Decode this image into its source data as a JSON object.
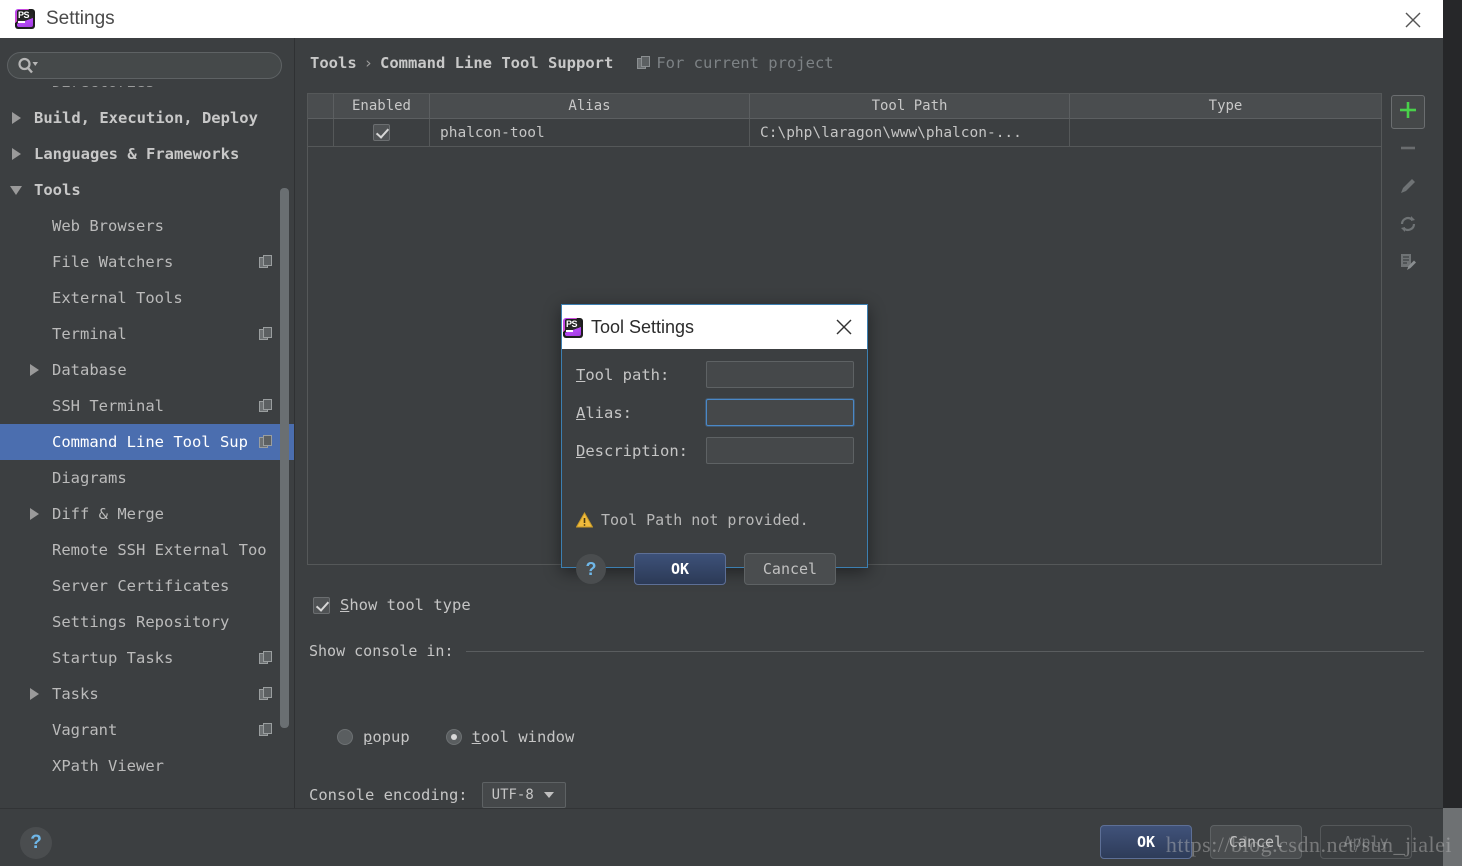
{
  "window": {
    "title": "Settings",
    "logo_text": "PS",
    "close_icon": "close-icon"
  },
  "sidebar": {
    "search": {
      "value": "",
      "placeholder": "",
      "icon": "search-icon"
    },
    "items": [
      {
        "label": "Directories",
        "level": 1,
        "arrow": "none",
        "copy": true,
        "clipped": true,
        "selected": false
      },
      {
        "label": "Build, Execution, Deploy",
        "level": 0,
        "arrow": "right",
        "copy": false,
        "clipped": false,
        "selected": false
      },
      {
        "label": "Languages & Frameworks",
        "level": 0,
        "arrow": "right",
        "copy": false,
        "clipped": false,
        "selected": false
      },
      {
        "label": "Tools",
        "level": 0,
        "arrow": "down",
        "copy": false,
        "clipped": false,
        "selected": false
      },
      {
        "label": "Web Browsers",
        "level": 1,
        "arrow": "none",
        "copy": false,
        "clipped": false,
        "selected": false
      },
      {
        "label": "File Watchers",
        "level": 1,
        "arrow": "none",
        "copy": true,
        "clipped": false,
        "selected": false
      },
      {
        "label": "External Tools",
        "level": 1,
        "arrow": "none",
        "copy": false,
        "clipped": false,
        "selected": false
      },
      {
        "label": "Terminal",
        "level": 1,
        "arrow": "none",
        "copy": true,
        "clipped": false,
        "selected": false
      },
      {
        "label": "Database",
        "level": 1,
        "arrow": "right",
        "copy": false,
        "clipped": false,
        "selected": false
      },
      {
        "label": "SSH Terminal",
        "level": 1,
        "arrow": "none",
        "copy": true,
        "clipped": false,
        "selected": false
      },
      {
        "label": "Command Line Tool Sup",
        "level": 1,
        "arrow": "none",
        "copy": true,
        "clipped": false,
        "selected": true
      },
      {
        "label": "Diagrams",
        "level": 1,
        "arrow": "none",
        "copy": false,
        "clipped": false,
        "selected": false
      },
      {
        "label": "Diff & Merge",
        "level": 1,
        "arrow": "right",
        "copy": false,
        "clipped": false,
        "selected": false
      },
      {
        "label": "Remote SSH External Too",
        "level": 1,
        "arrow": "none",
        "copy": false,
        "clipped": false,
        "selected": false
      },
      {
        "label": "Server Certificates",
        "level": 1,
        "arrow": "none",
        "copy": false,
        "clipped": false,
        "selected": false
      },
      {
        "label": "Settings Repository",
        "level": 1,
        "arrow": "none",
        "copy": false,
        "clipped": false,
        "selected": false
      },
      {
        "label": "Startup Tasks",
        "level": 1,
        "arrow": "none",
        "copy": true,
        "clipped": false,
        "selected": false
      },
      {
        "label": "Tasks",
        "level": 1,
        "arrow": "right",
        "copy": true,
        "clipped": false,
        "selected": false
      },
      {
        "label": "Vagrant",
        "level": 1,
        "arrow": "none",
        "copy": true,
        "clipped": false,
        "selected": false
      },
      {
        "label": "XPath Viewer",
        "level": 1,
        "arrow": "none",
        "copy": false,
        "clipped": false,
        "selected": false
      }
    ]
  },
  "main": {
    "breadcrumb": {
      "root": "Tools",
      "separator": "›",
      "leaf": "Command Line Tool Support"
    },
    "scope_label": "For current project",
    "table": {
      "columns": [
        "",
        "Enabled",
        "Alias",
        "Tool Path",
        "Type"
      ],
      "rows": [
        {
          "enabled": true,
          "alias": "phalcon-tool",
          "tool_path": "C:\\php\\laragon\\www\\phalcon-...",
          "type": ""
        }
      ]
    },
    "toolbar": [
      {
        "name": "add-button",
        "icon": "plus-icon",
        "selected": true
      },
      {
        "name": "remove-button",
        "icon": "minus-icon",
        "selected": false
      },
      {
        "name": "edit-button",
        "icon": "pencil-icon",
        "selected": false
      },
      {
        "name": "refresh-button",
        "icon": "refresh-icon",
        "selected": false
      },
      {
        "name": "edit-document-button",
        "icon": "document-edit-icon",
        "selected": false
      }
    ],
    "show_tool_type": {
      "label": "Show tool type",
      "checked": true
    },
    "show_console_in": {
      "group_label": "Show console in:",
      "options": [
        {
          "label": "popup",
          "selected": false
        },
        {
          "label": "tool window",
          "selected": true
        }
      ]
    },
    "console_encoding": {
      "label": "Console encoding:",
      "value": "UTF-8"
    }
  },
  "bottom": {
    "help_icon": "?",
    "ok": "OK",
    "cancel": "Cancel",
    "apply": "Apply"
  },
  "dialog": {
    "title": "Tool Settings",
    "logo_text": "PS",
    "close_icon": "close-icon",
    "fields": [
      {
        "label": "Tool path:",
        "value": "",
        "focused": false
      },
      {
        "label": "Alias:",
        "value": "",
        "focused": true
      },
      {
        "label": "Description:",
        "value": "",
        "focused": false
      }
    ],
    "warning": {
      "icon": "warning-icon",
      "text": "Tool Path not provided."
    },
    "help_icon": "?",
    "ok": "OK",
    "cancel": "Cancel"
  },
  "watermark": "https://blog.csdn.net/sun_jialei"
}
